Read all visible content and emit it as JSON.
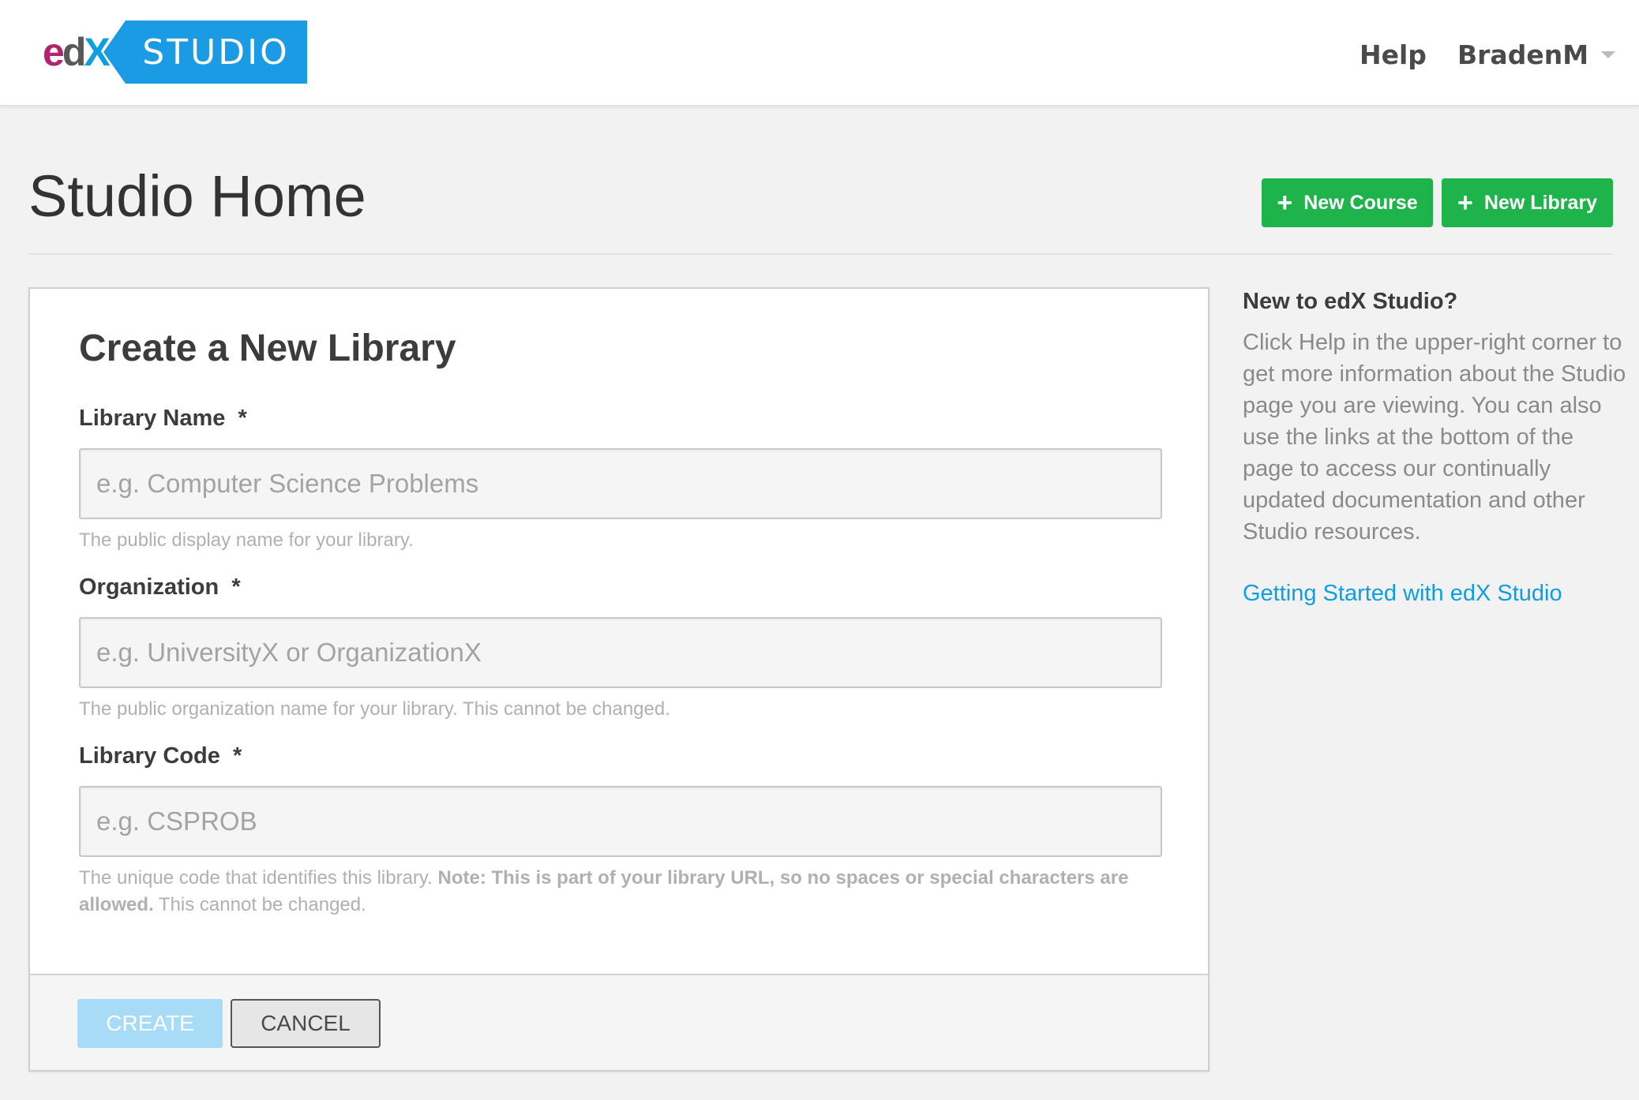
{
  "header": {
    "logo_edx": {
      "e": "e",
      "d": "d",
      "x": "X"
    },
    "logo_studio": "STUDIO",
    "help_label": "Help",
    "username": "BradenM"
  },
  "page": {
    "title": "Studio Home",
    "new_course_label": "New Course",
    "new_library_label": "New Library",
    "plus": "+"
  },
  "form": {
    "title": "Create a New Library",
    "fields": [
      {
        "label": "Library Name",
        "required_marker": "*",
        "value": "",
        "placeholder": "e.g. Computer Science Problems",
        "help": "The public display name for your library."
      },
      {
        "label": "Organization",
        "required_marker": "*",
        "value": "",
        "placeholder": "e.g. UniversityX or OrganizationX",
        "help": "The public organization name for your library. This cannot be changed."
      },
      {
        "label": "Library Code",
        "required_marker": "*",
        "value": "",
        "placeholder": "e.g. CSPROB",
        "help_prefix": "The unique code that identifies this library.",
        "help_note": "Note: This is part of your library URL, so no spaces or special characters are allowed.",
        "help_suffix": "This cannot be changed."
      }
    ],
    "create_label": "CREATE",
    "cancel_label": "CANCEL"
  },
  "sidebar": {
    "title": "New to edX Studio?",
    "body": "Click Help in the upper-right corner to get more information about the Studio page you are viewing. You can also use the links at the bottom of the page to access our continually updated documentation and other Studio resources.",
    "link_label": "Getting Started with edX Studio"
  },
  "colors": {
    "brand_blue": "#1a9be3",
    "edx_magenta": "#b1256d",
    "green": "#1fb34c",
    "link_blue": "#0e9ee1",
    "create_disabled": "#a8dbf6"
  }
}
